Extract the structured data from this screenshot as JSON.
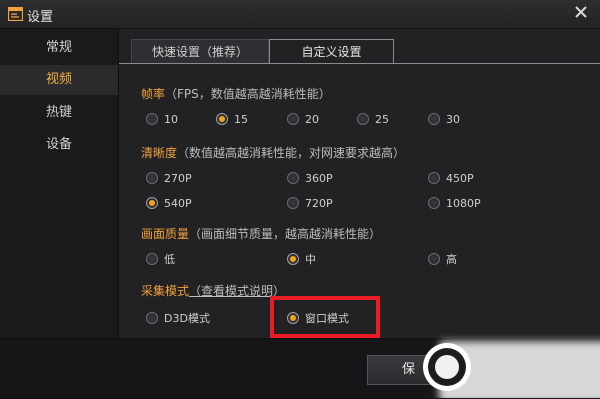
{
  "window": {
    "title": "设置"
  },
  "sidebar": {
    "items": [
      {
        "label": "常规"
      },
      {
        "label": "视频"
      },
      {
        "label": "热键"
      },
      {
        "label": "设备"
      }
    ],
    "active_index": 1
  },
  "tabs": [
    {
      "label": "快速设置（推荐）"
    },
    {
      "label": "自定义设置"
    }
  ],
  "active_tab": 1,
  "sections": {
    "fps": {
      "title": "帧率",
      "note": "（FPS，数值越高越消耗性能）",
      "options": [
        "10",
        "15",
        "20",
        "25",
        "30"
      ],
      "selected": "15"
    },
    "resolution": {
      "title": "清晰度",
      "note": "（数值越高越消耗性能，对网速要求越高）",
      "options": [
        "270P",
        "360P",
        "450P",
        "540P",
        "720P",
        "1080P"
      ],
      "selected": "540P"
    },
    "quality": {
      "title": "画面质量",
      "note": "（画面细节质量，越高越消耗性能）",
      "options": [
        "低",
        "中",
        "高"
      ],
      "selected": "中"
    },
    "capture": {
      "title": "采集模式",
      "link": "（查看模式说明）",
      "options": [
        "D3D模式",
        "窗口模式"
      ],
      "selected": "窗口模式"
    }
  },
  "footer": {
    "save_label": "保"
  },
  "colors": {
    "accent": "#f3a23a",
    "radio_selected": "#f5a21f",
    "highlight": "#ea1c24",
    "background": "#222224"
  }
}
